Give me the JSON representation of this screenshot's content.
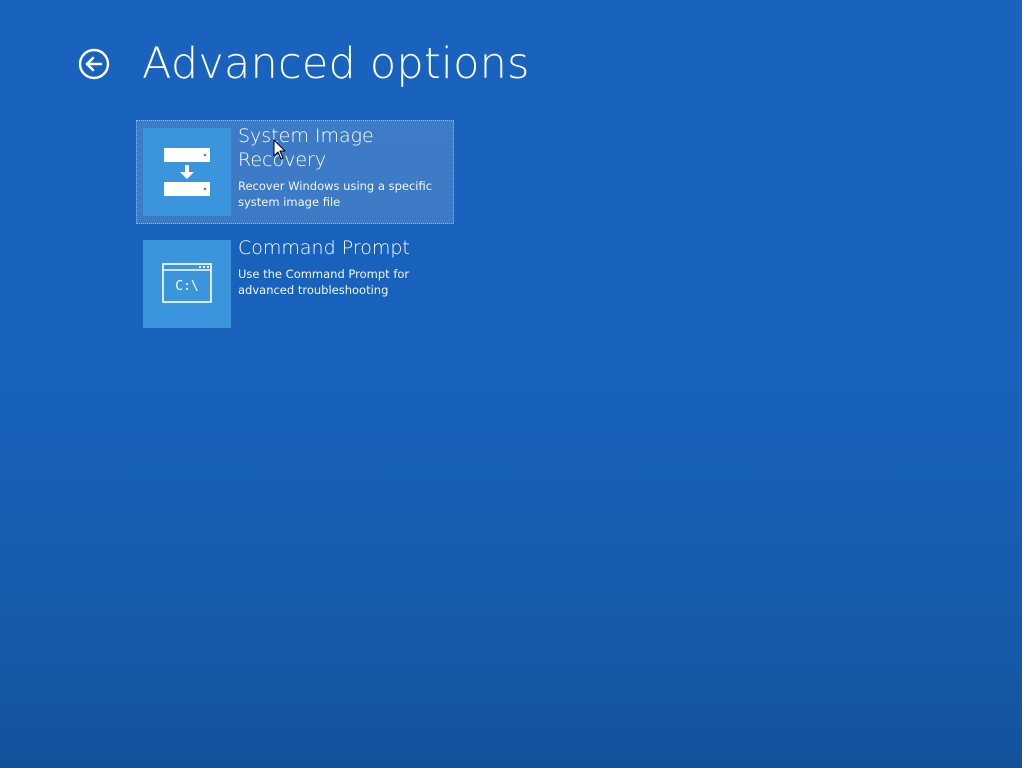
{
  "page": {
    "title": "Advanced options"
  },
  "icons": {
    "back": "back-arrow-circle-icon",
    "system_image": "drive-restore-icon",
    "command_prompt": "command-prompt-icon",
    "cursor": "mouse-pointer-icon"
  },
  "options": [
    {
      "title": "System Image Recovery",
      "description": "Recover Windows using a specific system image file",
      "selected": true
    },
    {
      "title": "Command Prompt",
      "description": "Use the Command Prompt for advanced troubleshooting",
      "selected": false,
      "tile_text": "C:\\"
    }
  ],
  "colors": {
    "background": "#1963bf",
    "tile": "#3a95dc",
    "text": "#ffffff"
  }
}
